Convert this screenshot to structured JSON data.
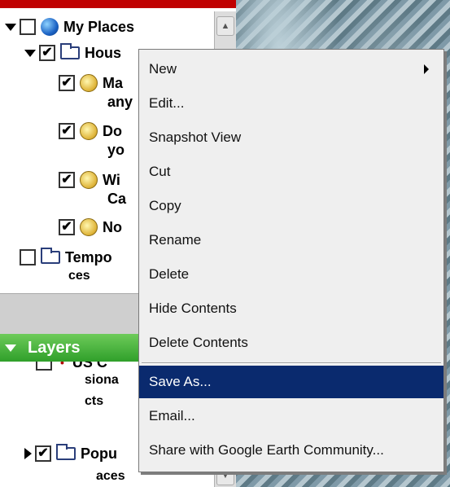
{
  "places": {
    "my_places": "My Places",
    "houses": "Hous",
    "items": [
      {
        "label": "Ma",
        "cont": "any"
      },
      {
        "label": "Do",
        "cont": "yo"
      },
      {
        "label": "Wi",
        "cont": "Ca"
      },
      {
        "label": "No",
        "cont": ""
      }
    ],
    "temp": "Tempo",
    "temp_cont": "ces"
  },
  "layers": {
    "title": "Layers",
    "us_label": "US C",
    "us_cont1": "siona",
    "us_cont2": "cts",
    "popular_label": "Popu",
    "popular_cont": "aces"
  },
  "context_menu": {
    "items": [
      "New",
      "Edit...",
      "Snapshot View",
      "Cut",
      "Copy",
      "Rename",
      "Delete",
      "Hide Contents",
      "Delete Contents",
      "Save As...",
      "Email...",
      "Share with Google Earth Community..."
    ],
    "highlighted": "Save As..."
  },
  "check_mark": "✔",
  "colors": {
    "highlight": "#0a2a6e",
    "layers_green": "#2f9f2a",
    "topbar_red": "#c00000"
  }
}
